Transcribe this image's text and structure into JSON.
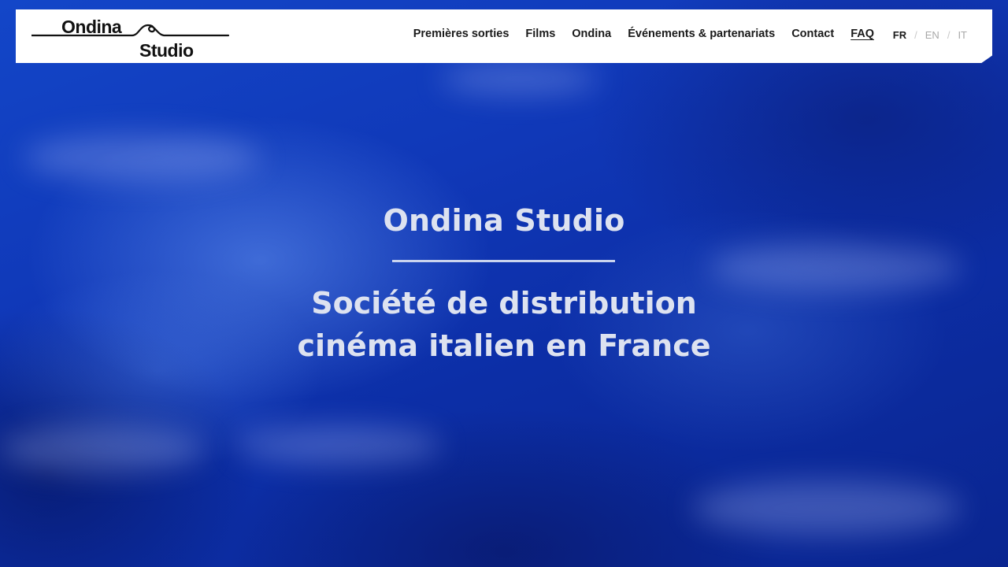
{
  "brand": {
    "logo_line1": "Ondina",
    "logo_line2": "Studio"
  },
  "nav": {
    "items": [
      {
        "label": "Premières sorties"
      },
      {
        "label": "Films"
      },
      {
        "label": "Ondina"
      },
      {
        "label": "Événements & partenariats"
      },
      {
        "label": "Contact"
      },
      {
        "label": "FAQ"
      }
    ]
  },
  "languages": {
    "items": [
      "FR",
      "EN",
      "IT"
    ],
    "active": "FR",
    "separator": "/"
  },
  "hero": {
    "title": "Ondina Studio",
    "subtitle_line1": "Société de distribution",
    "subtitle_line2": "cinéma italien en France"
  },
  "colors": {
    "background": "#0b2a9a",
    "header": "#ffffff",
    "hero_text": "#dde2f0",
    "nav_text": "#1a1a1a",
    "lang_inactive": "#a8a8a8"
  },
  "icons": {
    "logo_wave": "wave-icon"
  }
}
